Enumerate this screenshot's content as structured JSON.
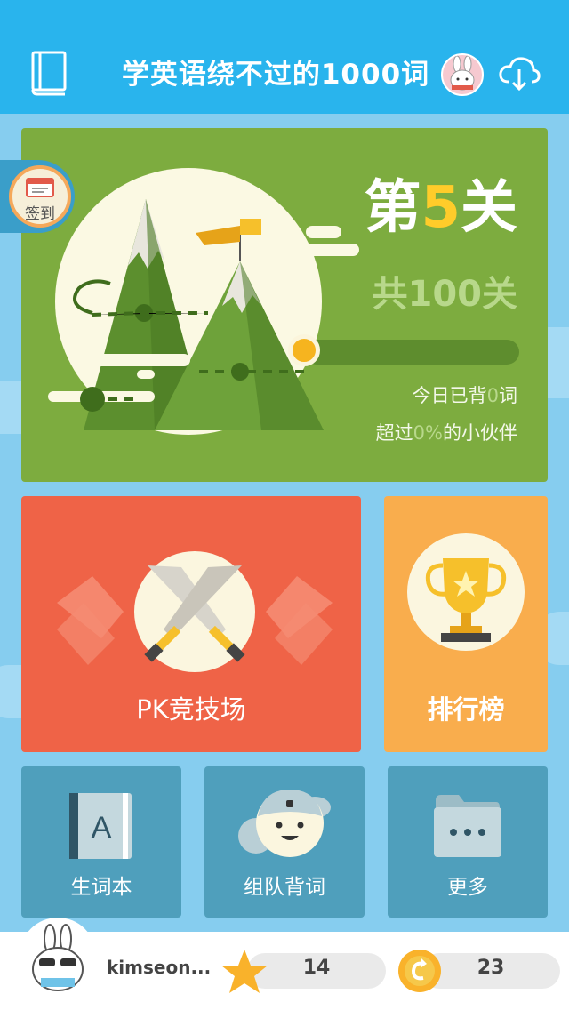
{
  "header": {
    "title": "学英语绕不过的1000词",
    "book_icon": "book-icon",
    "avatar": "bunny-avatar",
    "download_icon": "cloud-download-icon"
  },
  "signin": {
    "label": "签到",
    "icon": "calendar-icon"
  },
  "level": {
    "prefix": "第",
    "number": "5",
    "suffix": "关",
    "total": "共100关",
    "progress": 0.0,
    "today_prefix": "今日已背",
    "today_count": "0",
    "today_suffix": "词",
    "beat_prefix": "超过",
    "beat_percent": "0%",
    "beat_suffix": "的小伙伴"
  },
  "tiles": {
    "pk": {
      "label": "PK竞技场",
      "icon": "crossed-swords-icon"
    },
    "rank": {
      "label": "排行榜",
      "icon": "trophy-icon"
    },
    "wordbook": {
      "label": "生词本",
      "icon": "vocab-book-icon"
    },
    "team": {
      "label": "组队背词",
      "icon": "team-faces-icon"
    },
    "more": {
      "label": "更多",
      "icon": "folder-more-icon"
    }
  },
  "user": {
    "name": "kimseon...",
    "stars": "14",
    "coins": "23"
  },
  "colors": {
    "header": "#29b4ed",
    "level_card": "#7dac3f",
    "pk": "#ef6347",
    "rank": "#f9ad4d",
    "small_tiles": "#4f9fbc",
    "accent_yellow": "#ffcc2a"
  }
}
